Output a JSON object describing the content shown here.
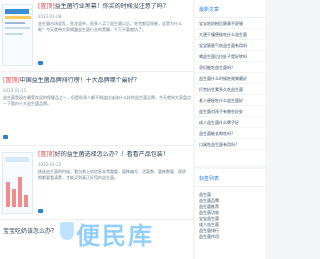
{
  "articles": [
    {
      "tag": "[置顶]",
      "title": "益生菌行业黑幕！你买的时候没注意了吗？",
      "date": "2023-01-08",
      "desc": "益生菌市场混乱，鱼龙混杂，很多人买了益生菌以后，吃完都没效果，这是为什么呢？今天就带大家揭露益生菌行业的黑幕，千万不要被坑了。"
    },
    {
      "tag": "[置顶]",
      "title": "中国益生菌品牌排行榜！十大品牌哪个最好？",
      "date": "2023-01-15",
      "desc": "益生菌是现在最受欢迎的保健品之一，但是很多人都不知道应该选什么样的益生菌品牌，今天就给大家盘点一下国内十大益生菌品牌。"
    },
    {
      "tag": "[置顶]",
      "title": "好的益生菌选择怎么办？！看看产品包装！",
      "date": "2023-01-22",
      "desc": "挑选益生菌的时候，看包装上的信息非常重要，菌株编号、活菌数、菌株数量、保质期都要看清楚，才能买到真正好用的益生菌。"
    }
  ],
  "last_article_title": "宝宝吃奶该怎么办？",
  "sidebar": {
    "latest_title": "最新文章",
    "latest_items": [
      "宝宝吃奶粉后肠胃不舒服",
      "大便干燥便秘吃什么益生菌",
      "宝宝肠胀气吃益生菌有用吗",
      "喝益生菌后拉肚子是好转吗",
      "孕妇能吃益生菌吗？",
      "益生菌什么时候吃效果最好",
      "打完抗生素多久吃益生菌",
      "老人便秘吃什么益生菌好",
      "益生菌对孩子有哪些好处",
      "成人益生菌什么牌子好",
      "益生菌能长期吃吗？",
      "口臭吃益生菌有用吗？"
    ],
    "tags_title": "标签列表",
    "tags": [
      "益生菌",
      "益生菌品牌",
      "益生菌推荐",
      "益生菌功效",
      "宝宝益生菌",
      "成人益生菌",
      "益生菌排行",
      "益生菌作用"
    ]
  },
  "watermark_text": "便民库",
  "colors": {
    "accent": "#2d7fd3",
    "tag": "#e63a3a"
  }
}
